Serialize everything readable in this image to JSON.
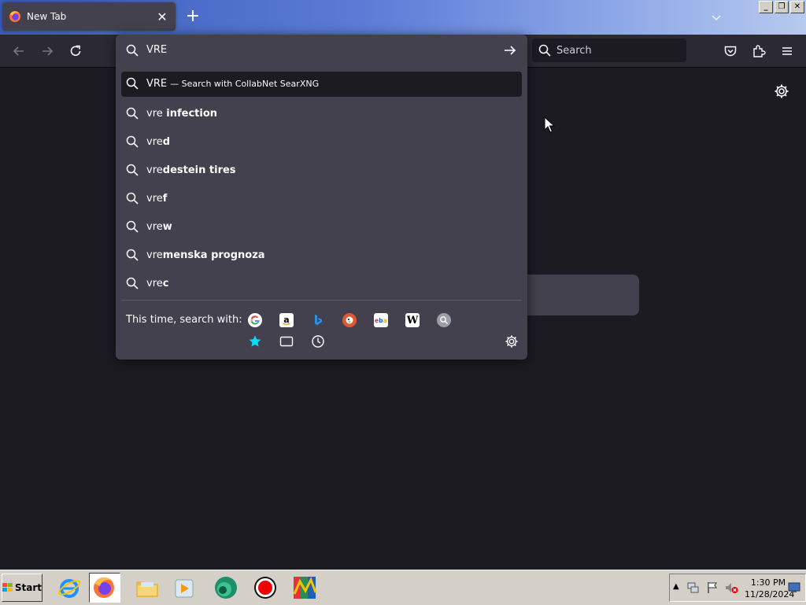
{
  "browser": {
    "tab": {
      "title": "New Tab",
      "favicon": "firefox-icon"
    },
    "accent_colors": {
      "toolbar": "#2b2a33",
      "panel": "#42414d",
      "page": "#1c1b22",
      "highlight": "#1c1b22"
    }
  },
  "navbar": {
    "search_placeholder": "Search"
  },
  "urlbar": {
    "value": "VRE",
    "results": [
      {
        "typed": "VRE",
        "suggestion": "",
        "action": "— Search with CollabNet SearXNG"
      },
      {
        "typed": "vre",
        "suggestion": " infection",
        "action": ""
      },
      {
        "typed": "vre",
        "suggestion": "d",
        "action": ""
      },
      {
        "typed": "vre",
        "suggestion": "destein tires",
        "action": ""
      },
      {
        "typed": "vre",
        "suggestion": "f",
        "action": ""
      },
      {
        "typed": "vre",
        "suggestion": "w",
        "action": ""
      },
      {
        "typed": "vre",
        "suggestion": "menska prognoza",
        "action": ""
      },
      {
        "typed": "vre",
        "suggestion": "c",
        "action": ""
      }
    ],
    "one_off_label": "This time, search with:",
    "engines": [
      "google-icon",
      "amazon-icon",
      "bing-icon",
      "duckduckgo-icon",
      "ebay-icon",
      "wikipedia-icon",
      "searxng-icon"
    ],
    "local_modes": [
      "bookmarks-icon",
      "tabs-icon",
      "history-icon"
    ]
  },
  "taskbar": {
    "start_label": "Start",
    "time": "1:30 PM",
    "date": "11/28/2024"
  }
}
